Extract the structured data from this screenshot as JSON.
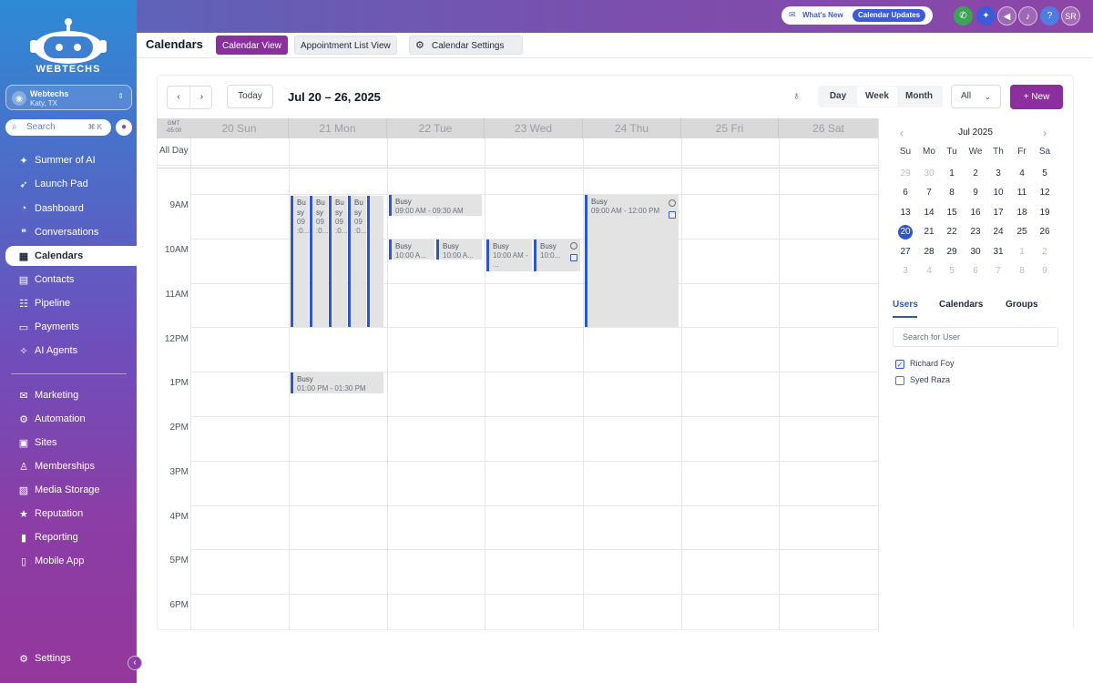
{
  "sidebar": {
    "brand": "WEBTECHS",
    "account": {
      "name": "Webtechs",
      "location": "Katy, TX"
    },
    "search": {
      "placeholder": "Search",
      "shortcut": "⌘ K"
    },
    "items_top": [
      {
        "label": "Summer of AI",
        "icon": "sparkles-icon"
      },
      {
        "label": "Launch Pad",
        "icon": "rocket-icon"
      },
      {
        "label": "Dashboard",
        "icon": "gauge-icon"
      },
      {
        "label": "Conversations",
        "icon": "chat-icon"
      },
      {
        "label": "Calendars",
        "icon": "calendar-icon",
        "active": true
      },
      {
        "label": "Contacts",
        "icon": "contacts-icon"
      },
      {
        "label": "Pipeline",
        "icon": "pipeline-icon"
      },
      {
        "label": "Payments",
        "icon": "payments-icon"
      },
      {
        "label": "AI Agents",
        "icon": "ai-agents-icon"
      }
    ],
    "items_bottom": [
      {
        "label": "Marketing",
        "icon": "marketing-icon"
      },
      {
        "label": "Automation",
        "icon": "automation-icon"
      },
      {
        "label": "Sites",
        "icon": "sites-icon"
      },
      {
        "label": "Memberships",
        "icon": "memberships-icon"
      },
      {
        "label": "Media Storage",
        "icon": "media-icon"
      },
      {
        "label": "Reputation",
        "icon": "reputation-icon"
      },
      {
        "label": "Reporting",
        "icon": "reporting-icon"
      },
      {
        "label": "Mobile App",
        "icon": "mobile-icon"
      }
    ],
    "settings": "Settings"
  },
  "topbar": {
    "whats_new": "What's New",
    "updates_pill": "Calendar Updates",
    "user_initials": "SR",
    "help": "?"
  },
  "header": {
    "title": "Calendars",
    "tabs": [
      {
        "label": "Calendar View",
        "selected": true
      },
      {
        "label": "Appointment List View",
        "selected": false
      },
      {
        "label": "Calendar Settings",
        "selected": false
      }
    ]
  },
  "toolbar": {
    "today": "Today",
    "range": "Jul 20 – 26, 2025",
    "views": [
      "Day",
      "Week",
      "Month"
    ],
    "active_view": "Week",
    "filter": "All",
    "new_button": "+ New"
  },
  "calendar": {
    "timezone_line1": "GMT",
    "timezone_line2": "-05:00",
    "all_day": "All Day",
    "days": [
      "20 Sun",
      "21 Mon",
      "22 Tue",
      "23 Wed",
      "24 Thu",
      "25 Fri",
      "26 Sat"
    ],
    "times": [
      "9AM",
      "10AM",
      "11AM",
      "12PM",
      "1PM",
      "2PM",
      "3PM",
      "4PM",
      "5PM",
      "6PM"
    ],
    "events": [
      {
        "title": "Bu sy",
        "time": "09 :0..."
      },
      {
        "title": "Bu sy",
        "time": "09 :0..."
      },
      {
        "title": "Bu sy",
        "time": "09 :0..."
      },
      {
        "title": "Bu sy",
        "time": "09 :0..."
      },
      {
        "title": "Busy",
        "time": "01:00 PM - 01:30 PM"
      },
      {
        "title": "Busy",
        "time": "09:00 AM - 09:30 AM"
      },
      {
        "title": "Busy",
        "time": "10:00 A..."
      },
      {
        "title": "Busy",
        "time": "10:00 A..."
      },
      {
        "title": "Busy",
        "time": "10:00 AM - ..."
      },
      {
        "title": "Busy",
        "time": "10:0..."
      },
      {
        "title": "Busy",
        "time": "09:00 AM - 12:00 PM"
      }
    ]
  },
  "mini_calendar": {
    "title": "Jul 2025",
    "dow": [
      "Su",
      "Mo",
      "Tu",
      "We",
      "Th",
      "Fr",
      "Sa"
    ],
    "weeks": [
      [
        "29",
        "30",
        "1",
        "2",
        "3",
        "4",
        "5"
      ],
      [
        "6",
        "7",
        "8",
        "9",
        "10",
        "11",
        "12"
      ],
      [
        "13",
        "14",
        "15",
        "16",
        "17",
        "18",
        "19"
      ],
      [
        "20",
        "21",
        "22",
        "23",
        "24",
        "25",
        "26"
      ],
      [
        "27",
        "28",
        "29",
        "30",
        "31",
        "1",
        "2"
      ],
      [
        "3",
        "4",
        "5",
        "6",
        "7",
        "8",
        "9"
      ]
    ],
    "today": "20"
  },
  "right_panel": {
    "tabs": [
      "Users",
      "Calendars",
      "Groups"
    ],
    "active_tab": "Users",
    "search_placeholder": "Search for User",
    "users": [
      {
        "name": "Richard Foy",
        "checked": true
      },
      {
        "name": "Syed Raza",
        "checked": false
      }
    ]
  },
  "colors": {
    "accent": "#8b2f9e",
    "event_border": "#2f56c9",
    "today": "#2f56c9"
  }
}
